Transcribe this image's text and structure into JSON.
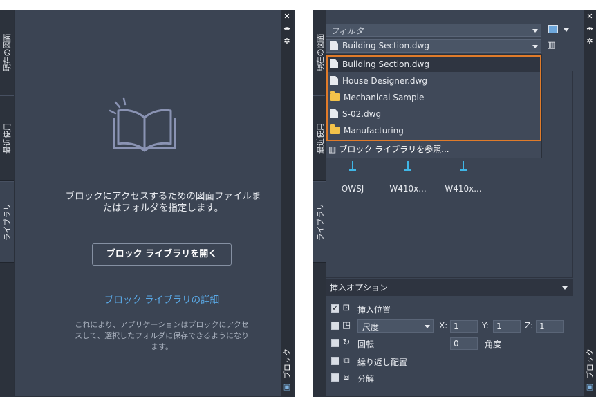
{
  "left_panel": {
    "tabs": [
      {
        "label": "現在の図面"
      },
      {
        "label": "最近使用"
      },
      {
        "label": "ライブラリ"
      }
    ],
    "titlebar_label": "ブロック",
    "message": "ブロックにアクセスするための図面ファイルまたはフォルダを指定します。",
    "open_button": "ブロック ライブラリを開く",
    "details_link": "ブロック ライブラリの詳細",
    "note": "これにより、アプリケーションはブロックにアクセスして、選択したフォルダに保存できるようになります。"
  },
  "right_panel": {
    "tabs": [
      {
        "label": "現在の図面"
      },
      {
        "label": "最近使用"
      },
      {
        "label": "ライブラリ"
      }
    ],
    "titlebar_label": "ブロック",
    "filter_placeholder": "フィルタ",
    "library_combo": "Building Section.dwg",
    "dropdown_items": [
      {
        "label": "Building Section.dwg",
        "icon": "file-icon"
      },
      {
        "label": "House Designer.dwg",
        "icon": "file-icon"
      },
      {
        "label": "Mechanical Sample",
        "icon": "folder-icon"
      },
      {
        "label": "S-02.dwg",
        "icon": "file-icon"
      },
      {
        "label": "Manufacturing",
        "icon": "folder-icon"
      }
    ],
    "browse_label": "ブロック ライブラリを参照...",
    "thumbnails": [
      "OWSJ",
      "W410x...",
      "W410x..."
    ],
    "options": {
      "header": "挿入オプション",
      "insertion_point": "挿入位置",
      "scale_mode": "尺度",
      "x_label": "X:",
      "y_label": "Y:",
      "z_label": "Z:",
      "x_value": "1",
      "y_value": "1",
      "z_value": "1",
      "rotation": "回転",
      "angle_value": "0",
      "angle_label": "角度",
      "repeat_placement": "繰り返し配置",
      "explode": "分解"
    }
  },
  "colors": {
    "accent_highlight": "#e07b2a",
    "link": "#5aa9e6",
    "panel_bg": "#3b4453"
  }
}
